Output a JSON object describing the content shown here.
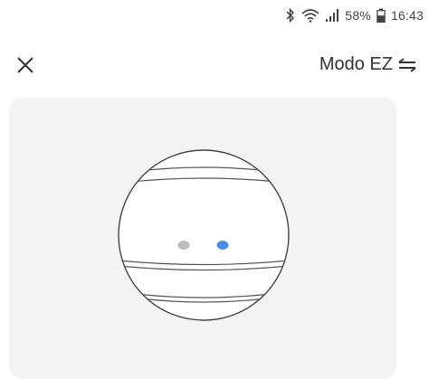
{
  "status_bar": {
    "battery_percent": "58%",
    "time": "16:43",
    "icons": [
      "bluetooth-icon",
      "wifi-icon",
      "signal-icon",
      "battery-icon"
    ]
  },
  "header": {
    "close_icon": "close-icon",
    "mode_label": "Modo EZ",
    "mode_icon": "swap-arrows-icon"
  },
  "illustration": {
    "indicator_left_color": "#bdbdbd",
    "indicator_right_color": "#4a90e2"
  }
}
